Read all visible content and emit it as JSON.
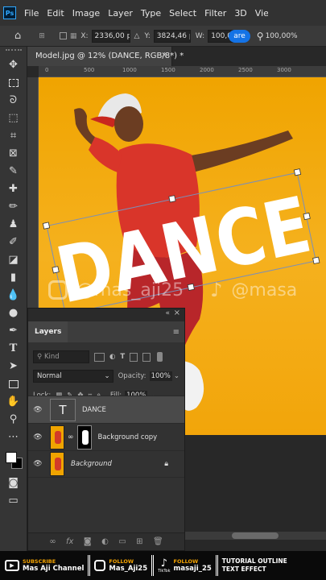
{
  "menubar": {
    "logo": "Ps",
    "items": [
      "File",
      "Edit",
      "Image",
      "Layer",
      "Type",
      "Select",
      "Filter",
      "3D",
      "View"
    ]
  },
  "options": {
    "x_label": "X:",
    "x_value": "2336,00 p",
    "y_label": "Y:",
    "y_value": "3824,46 p",
    "w_label": "W:",
    "w_value": "100,00%",
    "share_label": "are",
    "zoom_value": "100,00%"
  },
  "document": {
    "tab_title": "Model.jpg @ 12% (DANCE, RGB/8*) *",
    "ruler_top_marks": [
      "0",
      "500",
      "1000",
      "1500",
      "2000",
      "2500",
      "3000"
    ],
    "ruler_left_marks": [
      "1000",
      "1500",
      "2000",
      "2500",
      "3000",
      "3500"
    ],
    "canvas_text": "DANCE"
  },
  "watermark": {
    "left_text": "@mas_aji25",
    "right_text": "@masa"
  },
  "layers_panel": {
    "tab": "Layers",
    "filter_placeholder": "Kind",
    "blend_mode": "Normal",
    "opacity_label": "Opacity:",
    "opacity_value": "100%",
    "lock_label": "Lock:",
    "fill_label": "Fill:",
    "fill_value": "100%",
    "layers": [
      {
        "name": "DANCE",
        "type": "text",
        "selected": true
      },
      {
        "name": "Background copy",
        "type": "image-mask",
        "selected": false
      },
      {
        "name": "Background",
        "type": "image",
        "selected": false,
        "locked": true
      }
    ]
  },
  "footer_banner": {
    "subscribe_small": "SUBSCRIBE",
    "subscribe_big": "Mas Aji Channel",
    "ig_small": "FOLLOW",
    "ig_big": "Mas_Aji25",
    "tt_brand": "TikTok",
    "tt_small": "FOLLOW",
    "tt_big": "masaji_25",
    "tutorial_line1": "TUTORIAL OUTLINE",
    "tutorial_line2": "TEXT EFFECT"
  },
  "colors": {
    "photo_bg": "#f2a60a",
    "shirt": "#d9352a",
    "text_fill": "#ffffff",
    "accent": "#f4a300",
    "ps_blue": "#31a8ff",
    "share_blue": "#1473e6"
  }
}
